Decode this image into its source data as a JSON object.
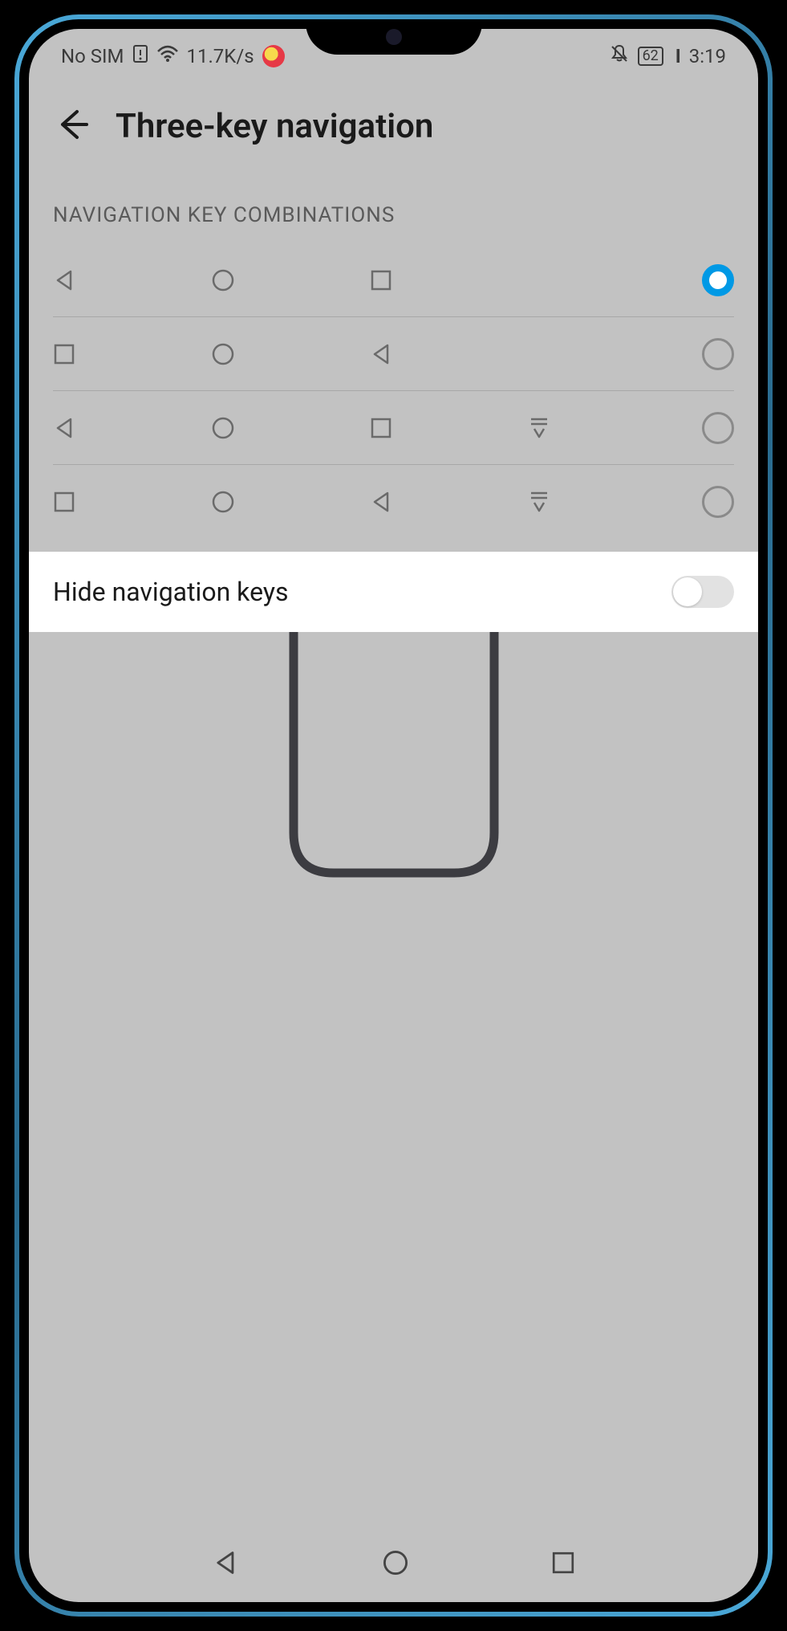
{
  "status": {
    "sim": "No SIM",
    "speed": "11.7K/s",
    "battery": "62",
    "time": "3:19"
  },
  "header": {
    "title": "Three-key navigation"
  },
  "section_label": "NAVIGATION KEY COMBINATIONS",
  "options": [
    {
      "keys": [
        "back",
        "home",
        "recent",
        null
      ],
      "selected": true
    },
    {
      "keys": [
        "recent",
        "home",
        "back",
        null
      ],
      "selected": false
    },
    {
      "keys": [
        "back",
        "home",
        "recent",
        "notif"
      ],
      "selected": false
    },
    {
      "keys": [
        "recent",
        "home",
        "back",
        "notif"
      ],
      "selected": false
    }
  ],
  "hide_nav": {
    "label": "Hide navigation keys",
    "enabled": false
  },
  "colors": {
    "accent": "#0099e5",
    "bg_dim": "#c2c2c2",
    "bg_white": "#ffffff"
  }
}
